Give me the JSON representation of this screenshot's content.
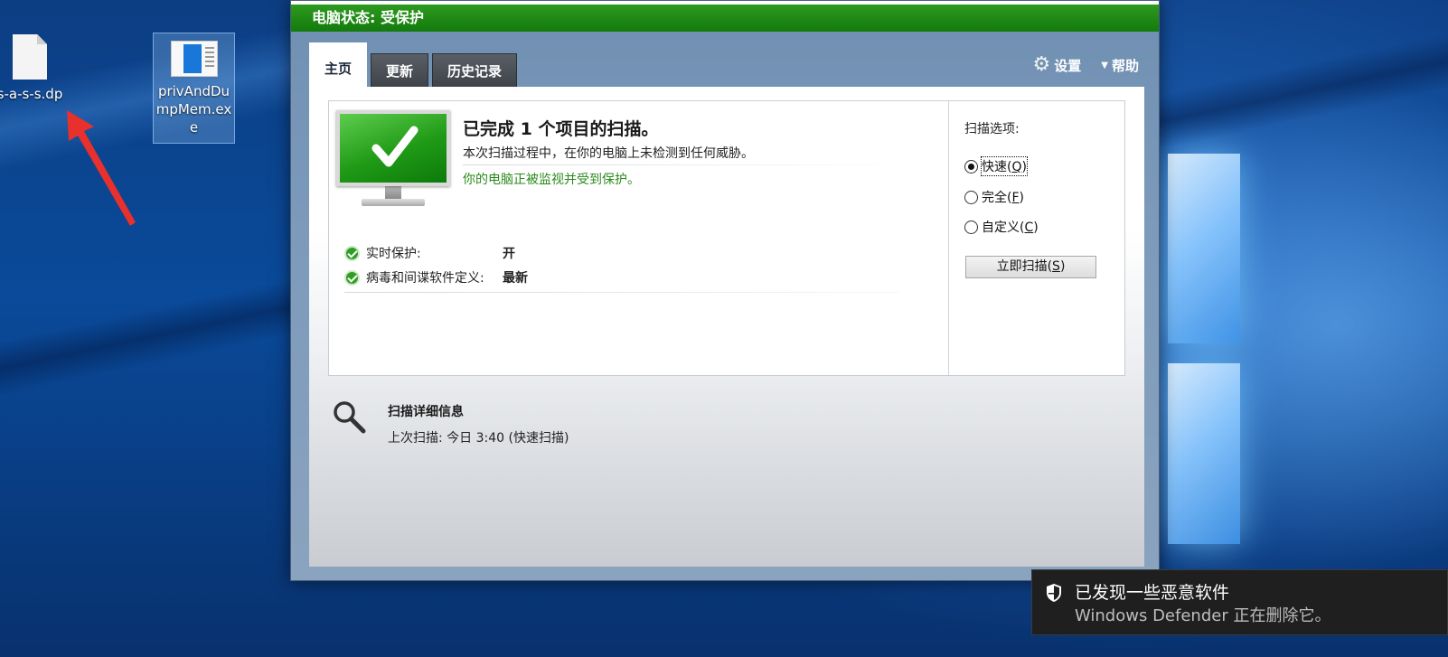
{
  "desktop": {
    "icons": [
      {
        "label": "s-a-s-s.dp"
      },
      {
        "label": "privAndDumpMem.exe",
        "label_lines": [
          "privAndDu",
          "mpMem.ex",
          "e"
        ]
      }
    ]
  },
  "defender": {
    "status_title": "电脑状态: 受保护",
    "status_color": "#1a8a12",
    "tabs": [
      {
        "label": "主页",
        "active": true
      },
      {
        "label": "更新",
        "active": false
      },
      {
        "label": "历史记录",
        "active": false
      }
    ],
    "top_links": {
      "settings": {
        "label": "设置",
        "icon": "gear-icon"
      },
      "help": {
        "label": "帮助",
        "icon": "caret-down-icon"
      }
    },
    "scan_result": {
      "title": "已完成 1 个项目的扫描。",
      "subtitle": "本次扫描过程中，在你的电脑上未检测到任何威胁。",
      "protected": "你的电脑正被监视并受到保护。"
    },
    "status_rows": [
      {
        "label": "实时保护:",
        "value": "开"
      },
      {
        "label": "病毒和间谍软件定义:",
        "value": "最新"
      }
    ],
    "scan_options": {
      "title": "扫描选项:",
      "options": [
        {
          "text": "快速(",
          "key": "Q",
          "end": ")",
          "selected": true
        },
        {
          "text": "完全(",
          "key": "F",
          "end": ")",
          "selected": false
        },
        {
          "text": "自定义(",
          "key": "C",
          "end": ")",
          "selected": false
        }
      ],
      "button": {
        "text": "立即扫描(",
        "key": "S",
        "end": ")"
      }
    },
    "scan_details": {
      "title": "扫描详细信息",
      "last_scan": "上次扫描: 今日 3:40 (快速扫描)"
    }
  },
  "toast": {
    "icon": "shield-icon",
    "title": "已发现一些恶意软件",
    "message": "Windows Defender 正在删除它。"
  }
}
